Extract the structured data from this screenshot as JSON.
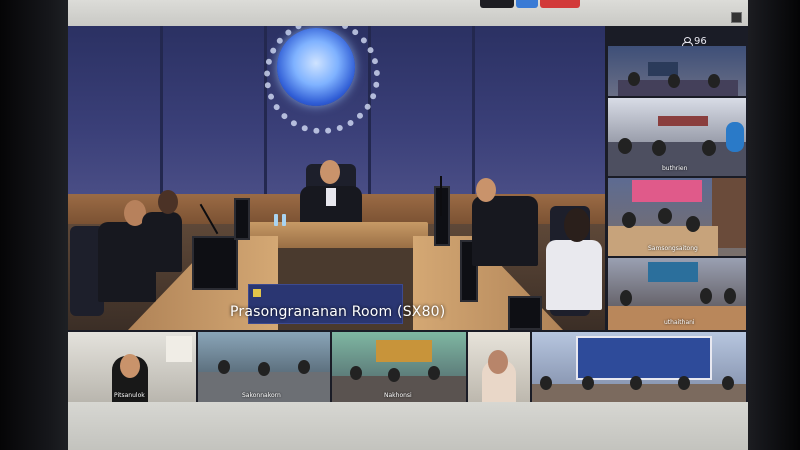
{
  "meeting": {
    "participant_count": "96",
    "main_tile_label": "Prasongrananan Room (SX80)"
  },
  "right_tiles": [
    {
      "label": ""
    },
    {
      "label": "buthrien"
    },
    {
      "label": "Samsongsaitong"
    },
    {
      "label": "uthaithani"
    }
  ],
  "bottom_tiles": [
    {
      "label": "Pitsanulok"
    },
    {
      "label": "Sakonnakorn"
    },
    {
      "label": "Nakhonsi"
    },
    {
      "label": ""
    },
    {
      "label": ""
    }
  ],
  "colors": {
    "backdrop": "#2b3163",
    "label_text": "#ffffff",
    "top_btn_1": "#1d1d22",
    "top_btn_2": "#3a7bd5",
    "top_btn_3": "#d23a3a"
  }
}
